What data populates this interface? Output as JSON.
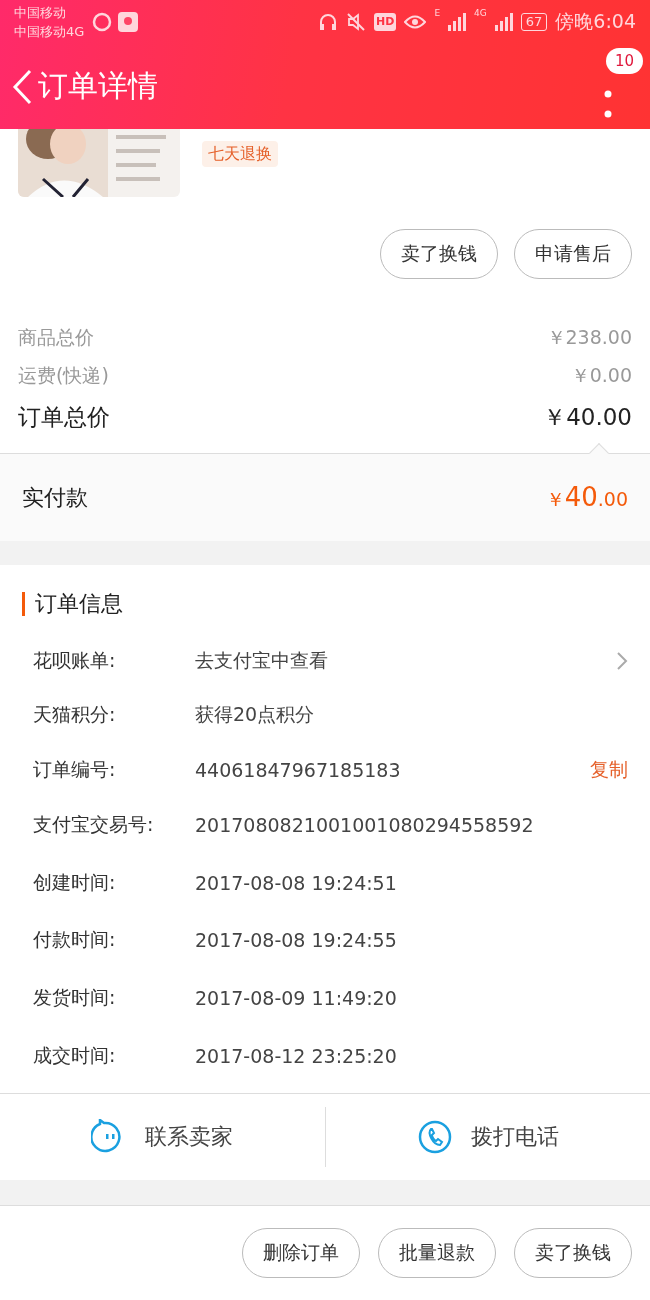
{
  "status_bar": {
    "carrier_1": "中国移动",
    "carrier_2": "中国移动4G",
    "hd_label": "HD",
    "signal_1_label": "E",
    "signal_2_label": "4G",
    "battery": "67",
    "time": "傍晚6:04"
  },
  "header": {
    "title": "订单详情",
    "badge": "10"
  },
  "product": {
    "tag": "七天退换"
  },
  "product_actions": [
    "卖了换钱",
    "申请售后"
  ],
  "prices": [
    {
      "label": "商品总价",
      "value": "￥238.00",
      "kind": "minor"
    },
    {
      "label": "运费(快递)",
      "value": "￥0.00",
      "kind": "minor"
    },
    {
      "label": "订单总价",
      "value": "￥40.00",
      "kind": "major"
    }
  ],
  "paid": {
    "label": "实付款",
    "currency": "￥",
    "amount": "40",
    "cents": ".00"
  },
  "order_info": {
    "title": "订单信息",
    "rows": [
      {
        "label": "花呗账单:",
        "value": "去支付宝中查看",
        "kind": "link"
      },
      {
        "label": "天猫积分:",
        "value": "获得20点积分",
        "kind": "plain"
      },
      {
        "label": "订单编号:",
        "value": "44061847967185183",
        "kind": "copy",
        "action": "复制"
      },
      {
        "label": "支付宝交易号:",
        "value": "2017080821001001080294558592",
        "kind": "plain"
      },
      {
        "label": "创建时间:",
        "value": "2017-08-08 19:24:51",
        "kind": "plain"
      },
      {
        "label": "付款时间:",
        "value": "2017-08-08 19:24:55",
        "kind": "plain"
      },
      {
        "label": "发货时间:",
        "value": "2017-08-09 11:49:20",
        "kind": "plain"
      },
      {
        "label": "成交时间:",
        "value": "2017-08-12 23:25:20",
        "kind": "plain"
      }
    ]
  },
  "contact": [
    {
      "label": "联系卖家",
      "kind": "chat"
    },
    {
      "label": "拨打电话",
      "kind": "phone"
    }
  ],
  "bottom_actions": [
    "删除订单",
    "批量退款",
    "卖了换钱"
  ]
}
